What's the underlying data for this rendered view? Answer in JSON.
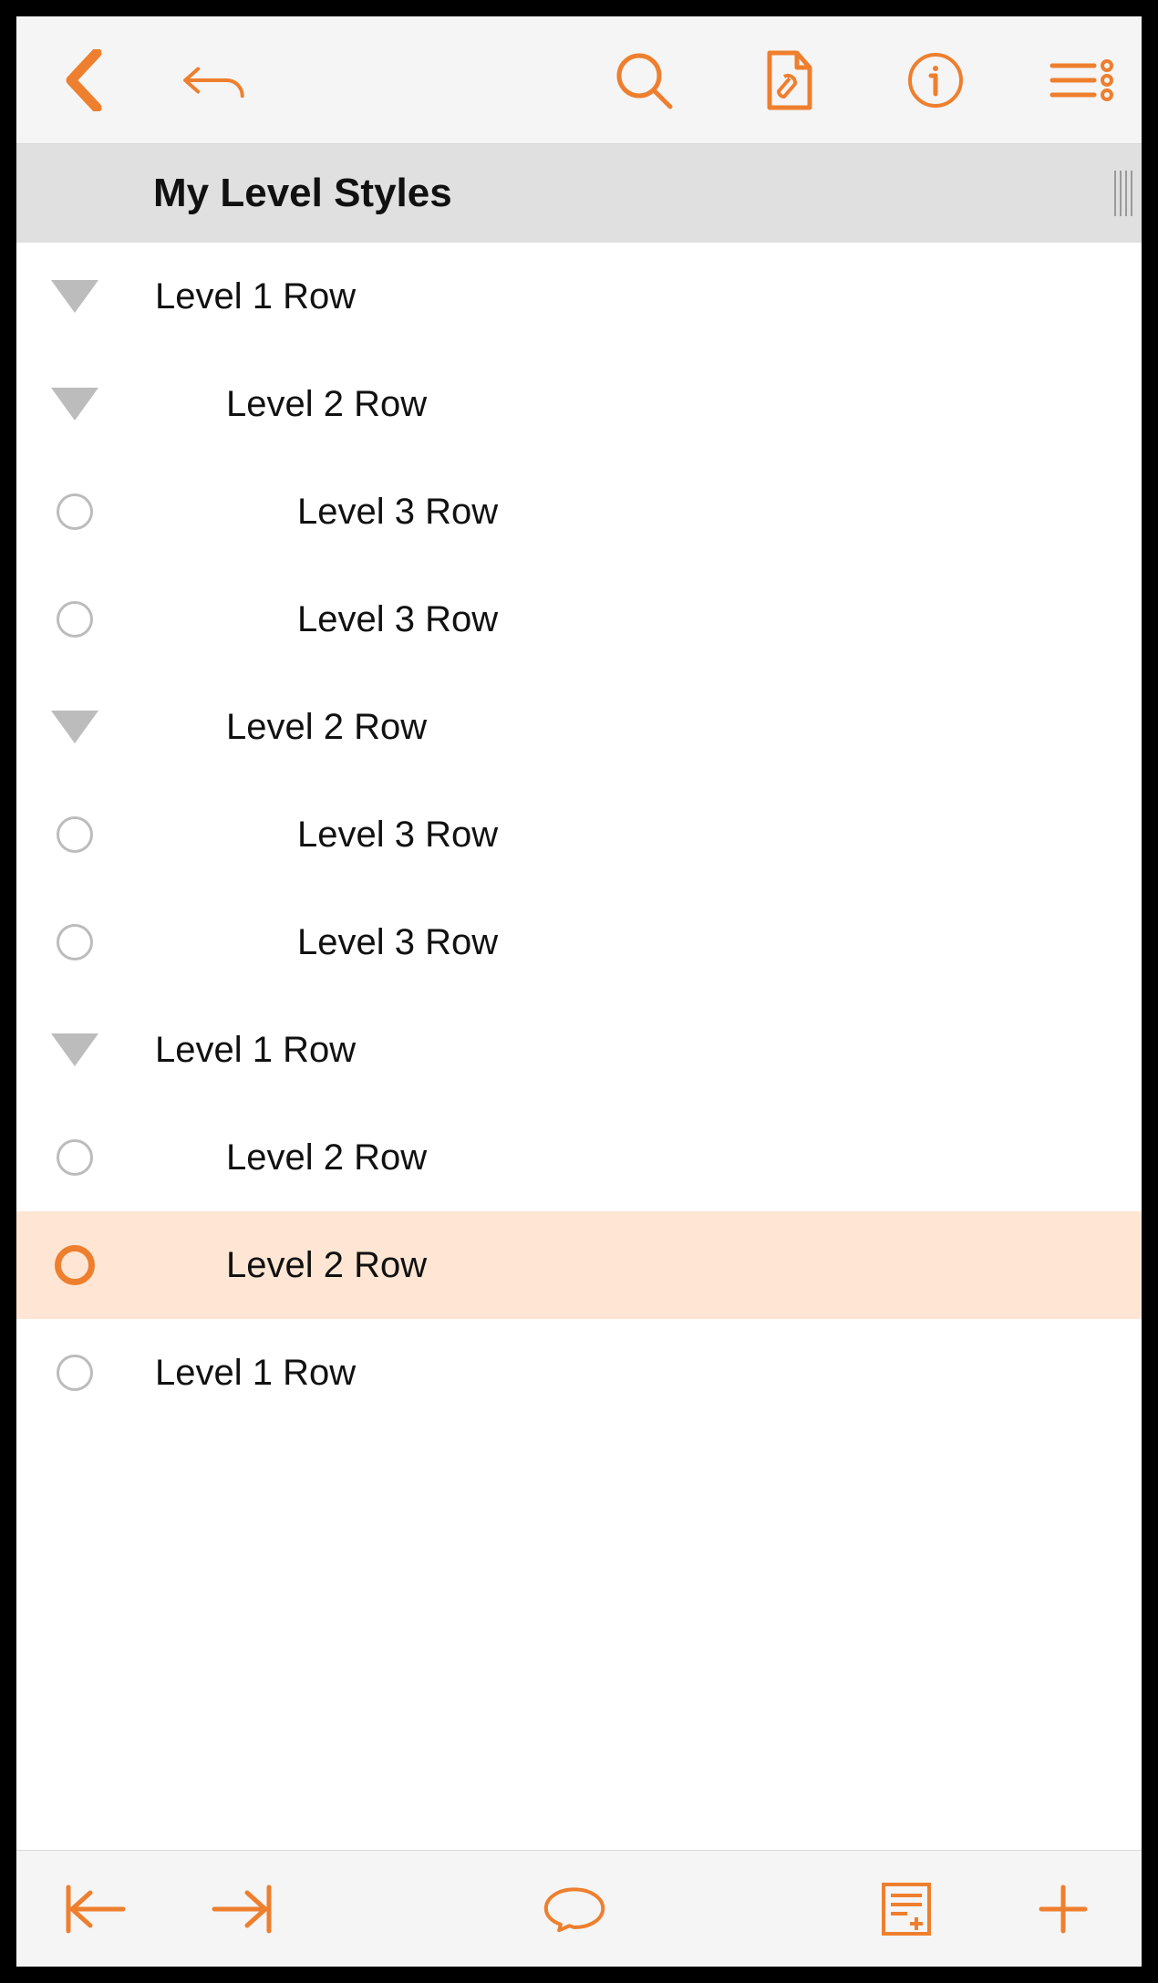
{
  "colors": {
    "accent": "#ee7f2e"
  },
  "header": {
    "title": "My Level Styles"
  },
  "rows": [
    {
      "label": "Level 1 Row",
      "kind": "triangle",
      "indent": 1,
      "selected": false
    },
    {
      "label": "Level 2 Row",
      "kind": "triangle",
      "indent": 2,
      "selected": false
    },
    {
      "label": "Level 3 Row",
      "kind": "circle",
      "indent": 3,
      "selected": false
    },
    {
      "label": "Level 3 Row",
      "kind": "circle",
      "indent": 3,
      "selected": false
    },
    {
      "label": "Level 2 Row",
      "kind": "triangle",
      "indent": 2,
      "selected": false
    },
    {
      "label": "Level 3 Row",
      "kind": "circle",
      "indent": 3,
      "selected": false
    },
    {
      "label": "Level 3 Row",
      "kind": "circle",
      "indent": 3,
      "selected": false
    },
    {
      "label": "Level 1 Row",
      "kind": "triangle",
      "indent": 1,
      "selected": false
    },
    {
      "label": "Level 2 Row",
      "kind": "circle",
      "indent": 2,
      "selected": false
    },
    {
      "label": "Level 2 Row",
      "kind": "circle",
      "indent": 2,
      "selected": true
    },
    {
      "label": "Level 1 Row",
      "kind": "circle",
      "indent": 1,
      "selected": false
    }
  ],
  "top_icons": {
    "back": "back-icon",
    "undo": "undo-icon",
    "search": "search-icon",
    "doc_settings": "document-settings-icon",
    "info": "info-icon",
    "more": "more-list-icon"
  },
  "bottom_icons": {
    "outdent": "outdent-icon",
    "indent": "indent-icon",
    "note": "note-icon",
    "attach": "add-note-icon",
    "add": "add-row-icon"
  }
}
